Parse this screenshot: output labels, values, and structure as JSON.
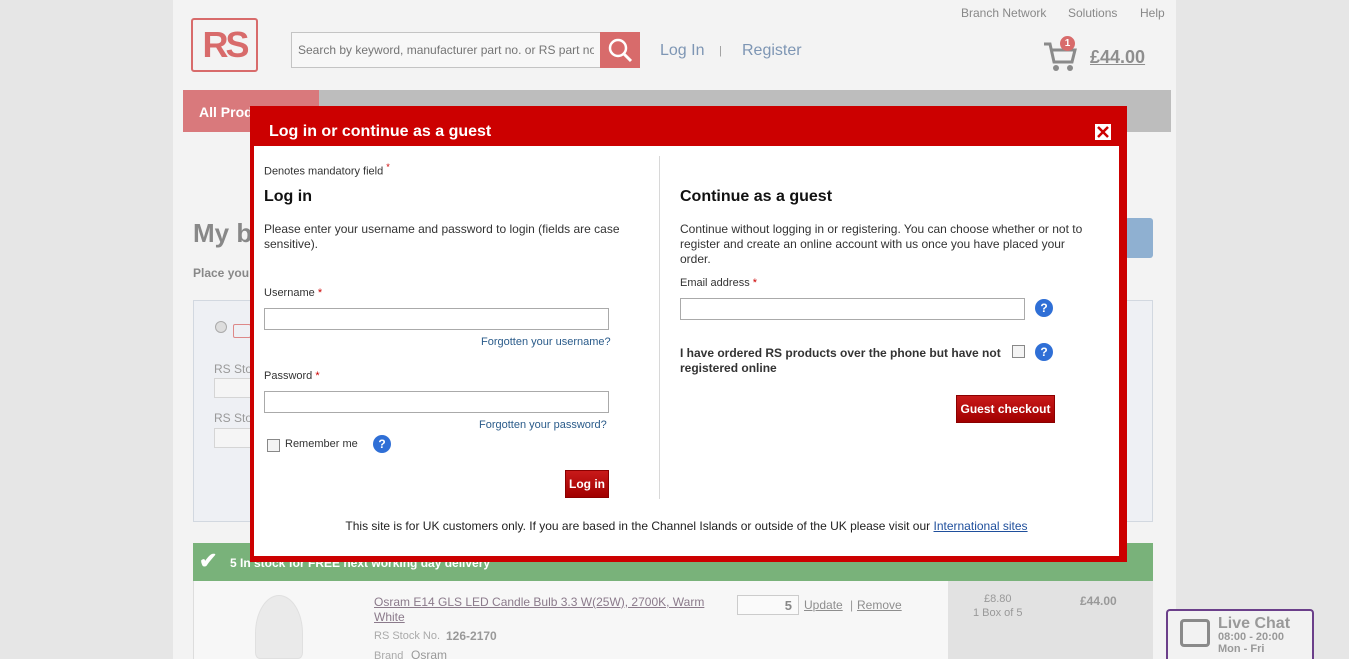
{
  "header": {
    "logo_text": "RS",
    "search_placeholder": "Search by keyword, manufacturer part no. or RS part no.",
    "login_link": "Log In",
    "register_link": "Register",
    "separator": "|",
    "top_links": [
      "Branch Network",
      "Solutions",
      "Help"
    ],
    "cart_count": "1",
    "cart_total": "£44.00"
  },
  "nav": {
    "all_products": "All Prod"
  },
  "basket": {
    "title": "My b",
    "subtitle": "Place you",
    "rs_stock_label_1": "RS Sto",
    "rs_stock_label_2": "RS Sto",
    "stock_banner": "5 In stock for FREE next working day delivery",
    "product": {
      "title": "Osram E14 GLS LED Candle Bulb 3.3 W(25W), 2700K, Warm White",
      "rs_stock_label": "RS Stock No.",
      "rs_stock_no": "126-2170",
      "brand_label": "Brand",
      "brand": "Osram",
      "qty": "5",
      "update": "Update",
      "sep": "|",
      "remove": "Remove",
      "unit_price": "£8.80",
      "unit_desc": "1 Box of 5",
      "line_total": "£44.00"
    }
  },
  "chat": {
    "title": "Live Chat",
    "hours": "08:00 - 20:00",
    "days": "Mon - Fri"
  },
  "modal": {
    "title": "Log in or continue as a guest",
    "mandatory_note": "Denotes mandatory field",
    "req_mark": "*",
    "login": {
      "heading": "Log in",
      "intro": "Please enter your username and password to login (fields are case sensitive).",
      "username_label": "Username",
      "username_value": "",
      "forgot_username": "Forgotten your username?",
      "password_label": "Password",
      "password_value": "",
      "forgot_password": "Forgotten your password?",
      "remember_label": "Remember me",
      "remember_checked": false,
      "submit": "Log in"
    },
    "guest": {
      "heading": "Continue as a guest",
      "intro": "Continue without logging in or registering. You can choose whether or not to register and create an online account with us once you have placed your order.",
      "email_label": "Email address",
      "email_value": "",
      "phone_order_label": "I have ordered RS products over the phone but have not registered online",
      "phone_order_checked": false,
      "submit": "Guest checkout"
    },
    "footer_text": "This site is for UK customers only. If you are based in the Channel Islands or outside of the UK please visit our ",
    "footer_link": "International sites"
  },
  "colors": {
    "brand_red": "#cc0000",
    "help_blue": "#2f6fd6",
    "link_blue": "#2a5b8a"
  }
}
